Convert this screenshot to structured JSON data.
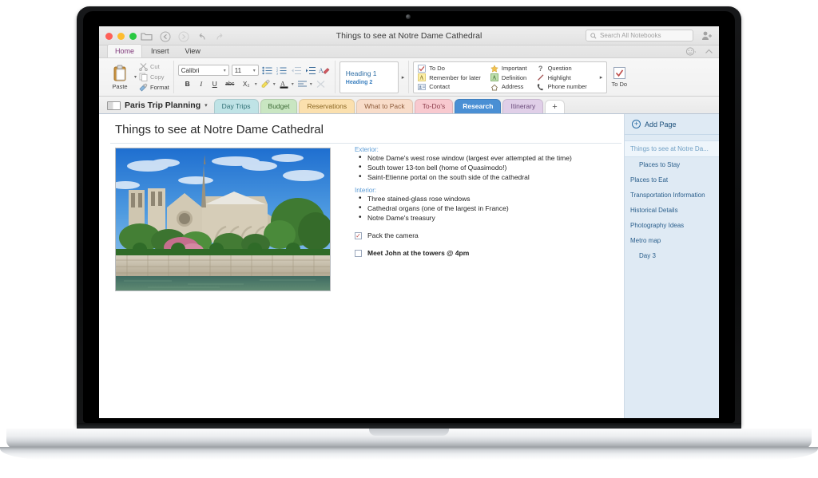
{
  "window": {
    "title": "Things to see at Notre Dame Cathedral",
    "traffic_lights": [
      "close",
      "minimize",
      "maximize"
    ],
    "toolbar_icons": [
      "notebook-icon",
      "back-icon",
      "forward-icon",
      "undo-icon",
      "redo-icon"
    ],
    "share_icon": "add-person-icon"
  },
  "search": {
    "placeholder": "Search All Notebooks",
    "icon": "search-icon"
  },
  "ribbon_tabs": [
    {
      "label": "Home",
      "active": true
    },
    {
      "label": "Insert",
      "active": false
    },
    {
      "label": "View",
      "active": false
    }
  ],
  "ribbon_right": {
    "emoji_icon": "smiley-icon",
    "collapse_icon": "chevron-up-icon"
  },
  "clipboard": {
    "paste_label": "Paste",
    "paste_icon": "clipboard-icon",
    "items": [
      {
        "label": "Cut",
        "icon": "scissors-icon",
        "enabled": false
      },
      {
        "label": "Copy",
        "icon": "copy-icon",
        "enabled": false
      },
      {
        "label": "Format",
        "icon": "format-painter-icon",
        "enabled": true
      }
    ]
  },
  "font": {
    "family": "Calibri",
    "size": "11",
    "row1_buttons": [
      {
        "name": "bulleted-list-button",
        "glyph": "bullets"
      },
      {
        "name": "numbered-list-button",
        "glyph": "numbers"
      },
      {
        "name": "decrease-indent-button",
        "glyph": "outdent"
      },
      {
        "name": "increase-indent-button",
        "glyph": "indent"
      },
      {
        "name": "styles-clear-button",
        "glyph": "eraser"
      }
    ],
    "row2_buttons": [
      {
        "name": "bold-button",
        "label": "B"
      },
      {
        "name": "italic-button",
        "label": "I"
      },
      {
        "name": "underline-button",
        "label": "U"
      },
      {
        "name": "strikethrough-button",
        "label": "abc"
      },
      {
        "name": "subscript-button",
        "label": "X₂"
      },
      {
        "name": "highlight-color-button",
        "label": "highlighter"
      },
      {
        "name": "font-color-button",
        "label": "A"
      },
      {
        "name": "align-button",
        "label": "align"
      },
      {
        "name": "clear-formatting-button",
        "label": "X"
      }
    ]
  },
  "styles": {
    "heading1": "Heading 1",
    "heading2": "Heading 2"
  },
  "tags": {
    "column1": [
      {
        "label": "To Do",
        "icon": "checkbox-icon"
      },
      {
        "label": "Remember for later",
        "icon": "yellow-a-icon"
      },
      {
        "label": "Contact",
        "icon": "contact-icon"
      }
    ],
    "column2": [
      {
        "label": "Important",
        "icon": "star-icon"
      },
      {
        "label": "Definition",
        "icon": "green-a-icon"
      },
      {
        "label": "Address",
        "icon": "house-icon"
      }
    ],
    "column3": [
      {
        "label": "Question",
        "icon": "question-mark-icon"
      },
      {
        "label": "Highlight",
        "icon": "pen-icon"
      },
      {
        "label": "Phone number",
        "icon": "phone-icon"
      }
    ],
    "todo_button": {
      "label": "To Do",
      "icon": "red-check-icon"
    }
  },
  "notebook": {
    "name": "Paris Trip Planning",
    "icon": "notebook-icon",
    "sections": [
      {
        "label": "Day Trips",
        "color": "#bfe3e6",
        "text_color": "#2f6f74",
        "active": false
      },
      {
        "label": "Budget",
        "color": "#c9e6c2",
        "text_color": "#3d6b36",
        "active": false
      },
      {
        "label": "Reservations",
        "color": "#fbe0ae",
        "text_color": "#8a6622",
        "active": false
      },
      {
        "label": "What to Pack",
        "color": "#f8dcc9",
        "text_color": "#8d5a3a",
        "active": false
      },
      {
        "label": "To-Do's",
        "color": "#f8c9cf",
        "text_color": "#8d3d4c",
        "active": false
      },
      {
        "label": "Research",
        "color": "#4a8fd4",
        "text_color": "#ffffff",
        "active": true
      },
      {
        "label": "Itinerary",
        "color": "#e0cfe8",
        "text_color": "#6a4a7a",
        "active": false
      }
    ],
    "add_section_label": "+"
  },
  "page": {
    "title": "Things to see at Notre Dame Cathedral",
    "image": {
      "name": "notre-dame-cathedral-photo",
      "alt": "Notre Dame Cathedral seen from across the Seine"
    },
    "groups": [
      {
        "heading": "Exterior:",
        "bullets": [
          "Notre Dame's west rose window (largest ever attempted at the time)",
          "South tower 13-ton bell (home of Quasimodo!)",
          "Saint-Etienne portal on the south side of the cathedral"
        ]
      },
      {
        "heading": "Interior:",
        "bullets": [
          "Three stained-glass rose windows",
          "Cathedral organs (one of the largest in France)",
          "Notre Dame's treasury"
        ]
      }
    ],
    "checkboxes": [
      {
        "label": "Pack the camera",
        "checked": true,
        "bold": false
      },
      {
        "label": "Meet John at the towers @ 4pm",
        "checked": false,
        "bold": true
      }
    ]
  },
  "page_list": {
    "add_page_label": "Add Page",
    "add_page_icon": "plus-circle-icon",
    "items": [
      {
        "label": "Things to see at Notre Da...",
        "sub": false,
        "active": true
      },
      {
        "label": "Places to Stay",
        "sub": true,
        "active": false
      },
      {
        "label": "Places to Eat",
        "sub": false,
        "active": false
      },
      {
        "label": "Transportation Information",
        "sub": false,
        "active": false
      },
      {
        "label": "Historical Details",
        "sub": false,
        "active": false
      },
      {
        "label": "Photography Ideas",
        "sub": false,
        "active": false
      },
      {
        "label": "Metro map",
        "sub": false,
        "active": false
      },
      {
        "label": "Day 3",
        "sub": true,
        "active": false
      }
    ]
  }
}
